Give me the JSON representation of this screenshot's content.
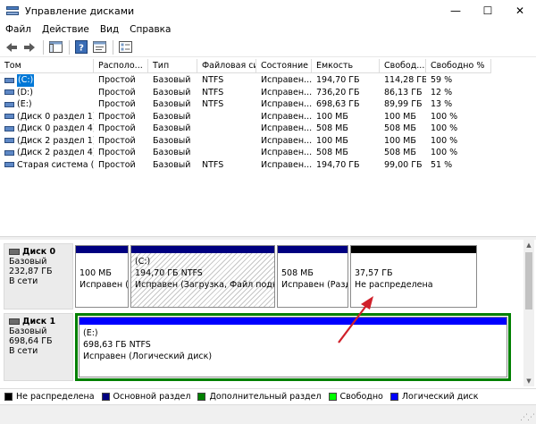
{
  "window": {
    "title": "Управление дисками",
    "minimize_glyph": "—",
    "maximize_glyph": "☐",
    "close_glyph": "✕"
  },
  "menu": [
    "Файл",
    "Действие",
    "Вид",
    "Справка"
  ],
  "toolbar": {
    "icons": [
      "back-icon",
      "forward-icon",
      "console-tree-icon",
      "help-icon",
      "properties-icon",
      "list-view-icon"
    ]
  },
  "volume_list": {
    "columns": [
      "Том",
      "Располо...",
      "Тип",
      "Файловая система",
      "Состояние",
      "Емкость",
      "Свобод...",
      "Свободно %"
    ],
    "rows": [
      {
        "tom": "(C:)",
        "location": "Простой",
        "type": "Базовый",
        "fs": "NTFS",
        "status": "Исправен...",
        "capacity": "194,70 ГБ",
        "free": "114,28 ГБ",
        "free_pct": "59 %",
        "selected": true
      },
      {
        "tom": "(D:)",
        "location": "Простой",
        "type": "Базовый",
        "fs": "NTFS",
        "status": "Исправен...",
        "capacity": "736,20 ГБ",
        "free": "86,13 ГБ",
        "free_pct": "12 %",
        "selected": false
      },
      {
        "tom": "(E:)",
        "location": "Простой",
        "type": "Базовый",
        "fs": "NTFS",
        "status": "Исправен...",
        "capacity": "698,63 ГБ",
        "free": "89,99 ГБ",
        "free_pct": "13 %",
        "selected": false
      },
      {
        "tom": "(Диск 0 раздел 1)",
        "location": "Простой",
        "type": "Базовый",
        "fs": "",
        "status": "Исправен...",
        "capacity": "100 МБ",
        "free": "100 МБ",
        "free_pct": "100 %",
        "selected": false
      },
      {
        "tom": "(Диск 0 раздел 4)",
        "location": "Простой",
        "type": "Базовый",
        "fs": "",
        "status": "Исправен...",
        "capacity": "508 МБ",
        "free": "508 МБ",
        "free_pct": "100 %",
        "selected": false
      },
      {
        "tom": "(Диск 2 раздел 1)",
        "location": "Простой",
        "type": "Базовый",
        "fs": "",
        "status": "Исправен...",
        "capacity": "100 МБ",
        "free": "100 МБ",
        "free_pct": "100 %",
        "selected": false
      },
      {
        "tom": "(Диск 2 раздел 4)",
        "location": "Простой",
        "type": "Базовый",
        "fs": "",
        "status": "Исправен...",
        "capacity": "508 МБ",
        "free": "508 МБ",
        "free_pct": "100 %",
        "selected": false
      },
      {
        "tom": "Старая система (F:)",
        "location": "Простой",
        "type": "Базовый",
        "fs": "NTFS",
        "status": "Исправен...",
        "capacity": "194,70 ГБ",
        "free": "99,00 ГБ",
        "free_pct": "51 %",
        "selected": false
      }
    ]
  },
  "disks": [
    {
      "name": "Диск 0",
      "type": "Базовый",
      "size": "232,87 ГБ",
      "state": "В сети",
      "partitions": [
        {
          "line1": "",
          "line2": "100 МБ",
          "line3": "Исправен (",
          "bar_color": "#000080",
          "hatched": false
        },
        {
          "line1": "(C:)",
          "line2": "194,70 ГБ NTFS",
          "line3": "Исправен (Загрузка, Файл подкачки",
          "bar_color": "#000080",
          "hatched": true
        },
        {
          "line1": "",
          "line2": "508 МБ",
          "line3": "Исправен (Разде",
          "bar_color": "#000080",
          "hatched": false
        },
        {
          "line1": "",
          "line2": "37,57 ГБ",
          "line3": "Не распределена",
          "bar_color": "#000000",
          "hatched": false
        }
      ]
    },
    {
      "name": "Диск 1",
      "type": "Базовый",
      "size": "698,64 ГБ",
      "state": "В сети",
      "partitions": [
        {
          "line1": "(E:)",
          "line2": "698,63 ГБ NTFS",
          "line3": "Исправен (Логический диск)",
          "bar_color": "#0000ff",
          "hatched": false
        }
      ]
    }
  ],
  "legend": [
    {
      "label": "Не распределена",
      "color": "#000000"
    },
    {
      "label": "Основной раздел",
      "color": "#000080"
    },
    {
      "label": "Дополнительный раздел",
      "color": "#008000"
    },
    {
      "label": "Свободно",
      "color": "#00ff00"
    },
    {
      "label": "Логический диск",
      "color": "#0000ff"
    }
  ],
  "colors": {
    "selection": "#0078d7",
    "annotation_arrow": "#d0202a"
  }
}
